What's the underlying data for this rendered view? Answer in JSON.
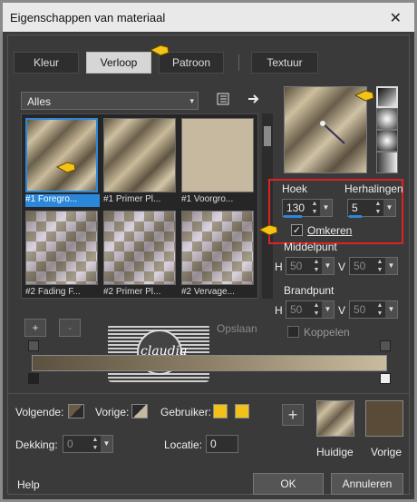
{
  "window": {
    "title": "Eigenschappen van materiaal",
    "close_glyph": "✕"
  },
  "tabs": [
    {
      "label": "Kleur",
      "active": false
    },
    {
      "label": "Verloop",
      "active": true
    },
    {
      "label": "Patroon",
      "active": false
    },
    {
      "label": "Textuur",
      "active": false
    }
  ],
  "category": {
    "value": "Alles",
    "arrow": "▾"
  },
  "gradients": [
    {
      "caption": "#1 Foregro...",
      "style": "gold",
      "selected": true
    },
    {
      "caption": "#1 Primer Pl...",
      "style": "gold",
      "selected": false
    },
    {
      "caption": "#1 Voorgro...",
      "style": "plain",
      "selected": false
    },
    {
      "caption": "#2 Fading F...",
      "style": "check",
      "selected": false
    },
    {
      "caption": "#2 Primer Pl...",
      "style": "check",
      "selected": false
    },
    {
      "caption": "#2 Vervage...",
      "style": "check",
      "selected": false
    }
  ],
  "controls": {
    "hoek_label": "Hoek",
    "hoek_value": "130",
    "herhalingen_label": "Herhalingen",
    "herhalingen_value": "5",
    "omkeren_label": "Omkeren",
    "omkeren_checked": true,
    "middelpunt_label": "Middelpunt",
    "brandpunt_label": "Brandpunt",
    "h_label": "H",
    "v_label": "V",
    "mid_h": "50",
    "mid_v": "50",
    "brand_h": "50",
    "brand_v": "50",
    "koppelen_label": "Koppelen",
    "opslaan_label": "Opslaan",
    "plus_label": "+",
    "minus_label": "-"
  },
  "bottom": {
    "volgende_label": "Volgende:",
    "vorige_label": "Vorige:",
    "gebruiker_label": "Gebruiker:",
    "dekking_label": "Dekking:",
    "dekking_value": "0",
    "locatie_label": "Locatie:",
    "locatie_value": "0",
    "huidige_label": "Huidige",
    "vorige2_label": "Vorige",
    "add_label": "+"
  },
  "footer": {
    "help": "Help",
    "ok": "OK",
    "cancel": "Annuleren"
  },
  "watermark": {
    "text": "claudia"
  },
  "colors": {
    "accent_blue": "#2b87d9",
    "highlight_red": "#dd2222",
    "user_swatch": "#f2c21b",
    "current_swatch_dark": "#5a4a38",
    "pointer_yellow": "#f3c316"
  }
}
